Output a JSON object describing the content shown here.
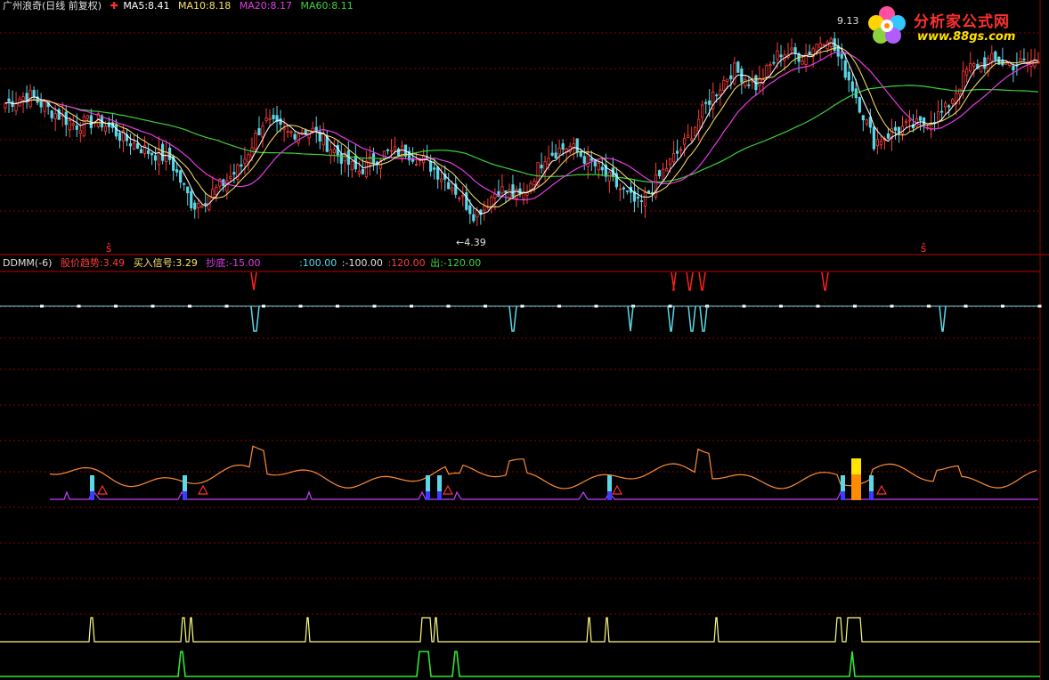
{
  "header": {
    "stock_title": "广州浪奇(日线 前复权)",
    "ma_marker": "✚",
    "ma5": "MA5:8.41",
    "ma10": "MA10:8.18",
    "ma20": "MA20:8.17",
    "ma60": "MA60:8.11"
  },
  "logo": {
    "title": "分析家公式网",
    "url": "www.88gs.com"
  },
  "indicator_header": {
    "name": "DDMM(-6)",
    "trend": "股价趋势:3.49",
    "buy": "买入信号:3.29",
    "bottom": "抄底:-15.00",
    "v100": ":100.00",
    "vneg100": ":-100.00",
    "v120": ":120.00",
    "out": "出:-120.00"
  },
  "annotations": {
    "high": "9.13",
    "low": "←4.39",
    "s1": "ŝ",
    "s2": "ŝ"
  },
  "colors": {
    "background": "#000000",
    "grid": "#8a0000",
    "up": "#ff3c3c",
    "down": "#5ad8e8",
    "ma5": "#ffffff",
    "ma10": "#ffe46a",
    "ma20": "#e43ce4",
    "ma60": "#3cd23c",
    "trend": "#ff8c32",
    "bottom": "#c83cff",
    "signal_yellow": "#ffff80",
    "signal_green": "#32e632"
  },
  "chart_data": [
    {
      "type": "candlestick",
      "title": "广州浪奇(日线 前复权)",
      "series": [
        "MA5",
        "MA10",
        "MA20",
        "MA60"
      ],
      "ylim": [
        4.0,
        9.6
      ],
      "annotations": [
        {
          "label": "9.13",
          "value": 9.13,
          "kind": "high"
        },
        {
          "label": "4.39",
          "value": 4.39,
          "kind": "low"
        }
      ],
      "close_trajectory": [
        7.4,
        7.6,
        7.2,
        6.9,
        7.0,
        6.6,
        6.3,
        6.1,
        5.0,
        5.4,
        5.9,
        7.0,
        6.7,
        6.8,
        6.3,
        5.8,
        6.2,
        6.3,
        6.0,
        5.5,
        4.8,
        5.4,
        5.2,
        6.2,
        6.4,
        6.0,
        5.5,
        5.0,
        5.8,
        6.5,
        7.5,
        8.2,
        7.8,
        8.6,
        8.5,
        9.0,
        7.9,
        6.5,
        6.8,
        6.9,
        7.2,
        8.2,
        8.4,
        8.3,
        8.4
      ]
    },
    {
      "type": "line",
      "title": "DDMM(-6)",
      "series": [
        "股价趋势",
        "买入信号",
        "抄底"
      ],
      "levels": [
        100,
        -100,
        120,
        -120
      ]
    }
  ]
}
